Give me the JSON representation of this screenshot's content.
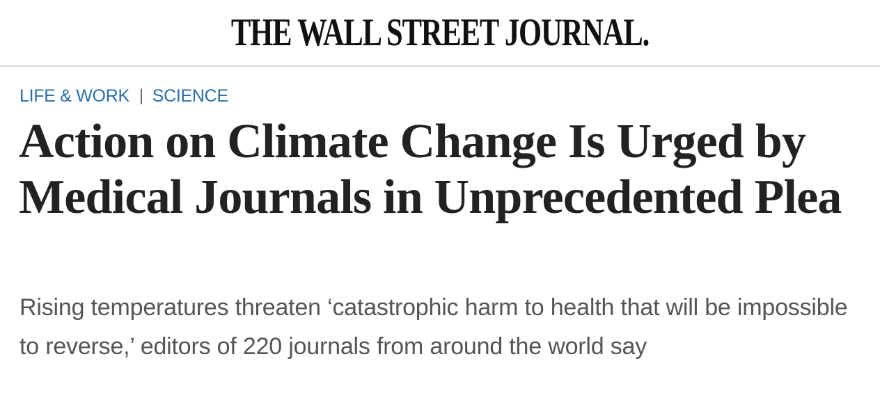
{
  "masthead": {
    "logo_text": "THE WALL STREET JOURNAL."
  },
  "breadcrumbs": [
    {
      "label": "LIFE & WORK"
    },
    {
      "label": "SCIENCE"
    }
  ],
  "breadcrumb_separator": "|",
  "article": {
    "headline": "Action on Climate Change Is Urged by Medical Journals in Unprecedented Plea",
    "dek": "Rising temperatures threaten ‘catastrophic harm to health that will be impossible to reverse,’ editors of 220 journals from around the world say"
  },
  "colors": {
    "breadcrumb_link": "#2a6fa8",
    "headline": "#222222",
    "dek": "#555555",
    "divider": "#dcdcdc"
  }
}
